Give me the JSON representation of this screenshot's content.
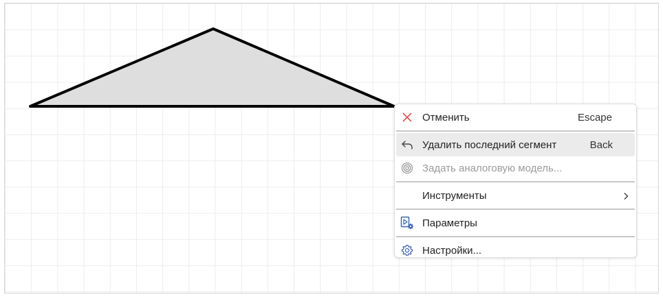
{
  "menu": {
    "items": [
      {
        "id": "cancel",
        "label": "Отменить",
        "shortcut": "Escape",
        "icon": "close-icon"
      },
      {
        "id": "delete-last",
        "label": "Удалить последний сегмент",
        "shortcut": "Back",
        "icon": "undo-arrow-icon"
      },
      {
        "id": "analog-model",
        "label": "Задать аналоговую модель...",
        "icon": "spiral-icon",
        "disabled": true
      },
      {
        "id": "tools",
        "label": "Инструменты",
        "icon": "",
        "submenu": true
      },
      {
        "id": "params",
        "label": "Параметры",
        "icon": "play-gear-icon"
      },
      {
        "id": "settings",
        "label": "Настройки...",
        "icon": "gear-icon"
      }
    ]
  },
  "colors": {
    "cancel_icon": "#d9534f",
    "blue_icon": "#3a5fb8",
    "shape_fill": "#dedede",
    "shape_stroke": "#000000",
    "grid": "#ececec"
  }
}
